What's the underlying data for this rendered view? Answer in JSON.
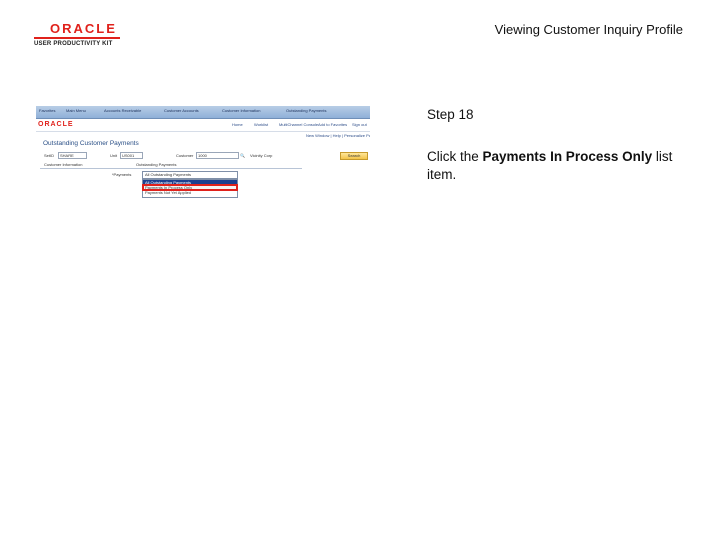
{
  "logo": {
    "word": "ORACLE",
    "sub": "USER PRODUCTIVITY KIT"
  },
  "page_title": "Viewing Customer Inquiry Profile",
  "thumbnail": {
    "nav_crumbs": [
      "Favorites",
      "Main Menu",
      "Accounts Receivable",
      "Customer Accounts",
      "Customer Information",
      "Outstanding Payments"
    ],
    "header_logo": "ORACLE",
    "header_links": [
      "Home",
      "Worklist",
      "MultiChannel Console",
      "Add to Favorites",
      "Sign out"
    ],
    "toolbar": "New Window | Help | Personalize Page",
    "heading": "Outstanding Customer Payments",
    "setid_label": "SetID",
    "setid_value": "SHARE",
    "unit_label": "Unit",
    "unit_value": "US001",
    "customer_label": "Customer",
    "customer_value": "1000",
    "customer_name": "Vicinity Corp",
    "search_button": "Search",
    "tab_labels": [
      "Customer Information",
      "Outstanding Payments"
    ],
    "payments_label": "*Payments",
    "dropdown_value": "All Outstanding Payments",
    "dropdown_options": [
      "All Outstanding Payments",
      "Payments In Process Only",
      "Payments Not Yet Applied"
    ]
  },
  "step": "Step 18",
  "instruction": {
    "prefix": "Click the ",
    "bold": "Payments In Process Only",
    "suffix": " list item."
  }
}
